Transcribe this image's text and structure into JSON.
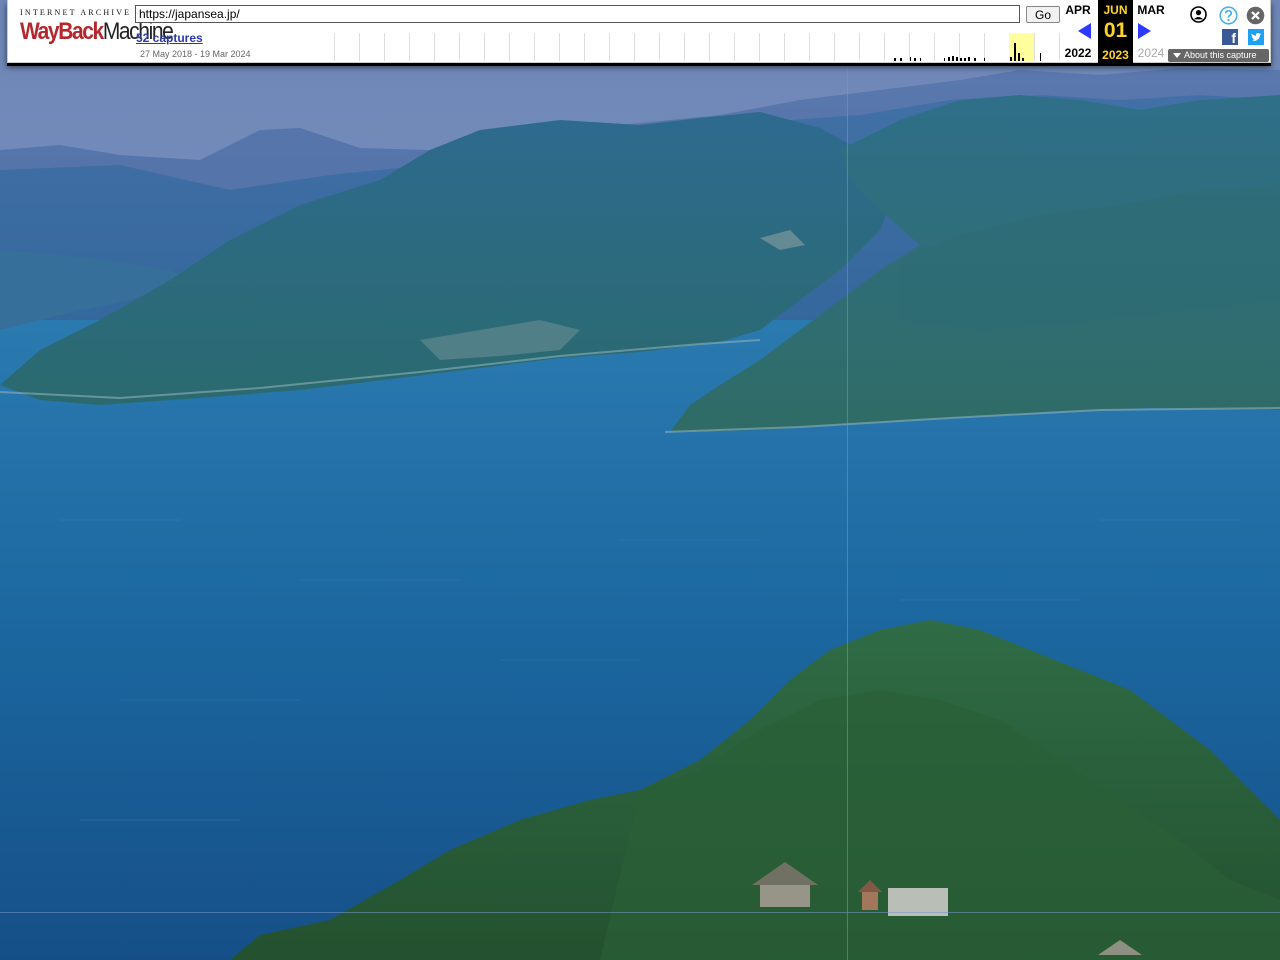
{
  "toolbar": {
    "logo_top": "INTERNET ARCHIVE",
    "logo_wayback": "WayBack",
    "logo_machine": "Machine",
    "url_value": "https://japansea.jp/",
    "go_label": "Go",
    "captures_label": "52 captures",
    "captures_range": "27 May 2018 - 19 Mar 2024",
    "prev_month": "APR",
    "prev_year": "2022",
    "current_month": "JUN",
    "current_day": "01",
    "current_year": "2023",
    "next_month": "MAR",
    "next_year": "2024",
    "about_label": "About this capture",
    "facebook_glyph": "f"
  },
  "icons": {
    "account": "account-icon",
    "help": "help-icon",
    "close": "close-icon",
    "facebook": "facebook-icon",
    "twitter": "twitter-icon"
  },
  "colors": {
    "wayback_red": "#b5272d",
    "link_blue": "#2e38a6",
    "arrow_blue": "#2d39ff",
    "current_yellow": "#ffd42a",
    "sea_blue": "#1a5f94"
  }
}
